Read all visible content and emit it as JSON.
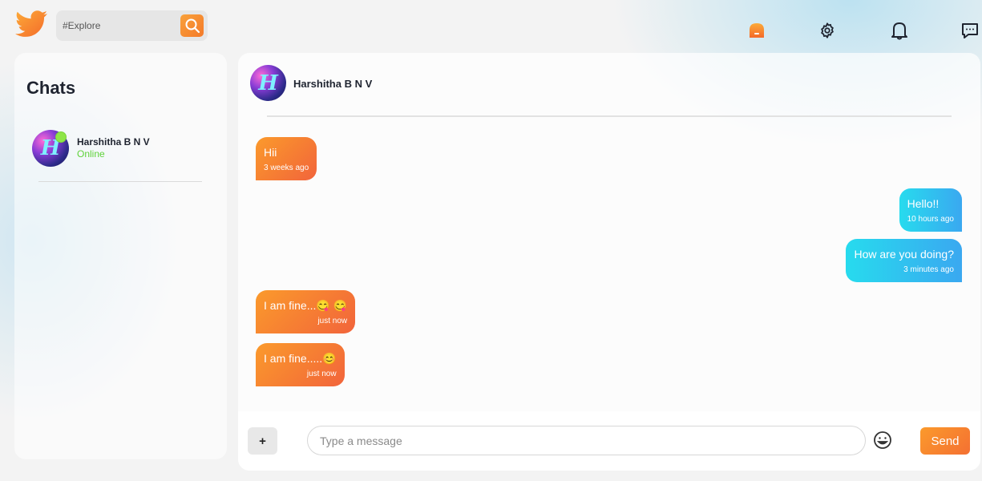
{
  "header": {
    "search_placeholder": "#Explore",
    "nav_icons": [
      "home-icon",
      "gear-icon",
      "bell-icon",
      "chat-bubble-icon"
    ],
    "accent_color": "#f47a2a"
  },
  "sidebar": {
    "title": "Chats",
    "chats": [
      {
        "name": "Harshitha B N V",
        "status": "Online",
        "avatar_letter": "H"
      }
    ]
  },
  "conversation": {
    "contact_name": "Harshitha B N V",
    "avatar_letter": "H",
    "messages": [
      {
        "text": "Hii",
        "time": "3 weeks ago",
        "direction": "in"
      },
      {
        "text": "Hello!!",
        "time": "10 hours ago",
        "direction": "out"
      },
      {
        "text": "How are you doing?",
        "time": "3 minutes ago",
        "direction": "out"
      },
      {
        "text": "I am fine...😋 😋",
        "time": "just now",
        "direction": "in"
      },
      {
        "text": "I am fine.....😊",
        "time": "just now",
        "direction": "in"
      }
    ]
  },
  "composer": {
    "attach_label": "+",
    "placeholder": "Type a message",
    "send_label": "Send"
  }
}
